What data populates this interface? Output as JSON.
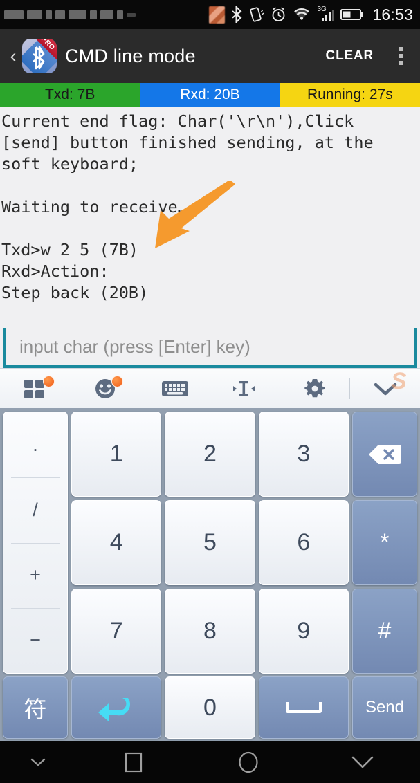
{
  "status_bar": {
    "time": "16:53",
    "network_label": "3G",
    "icons": [
      "notification-blurred",
      "bluetooth-icon",
      "vibrate-icon",
      "alarm-icon",
      "wifi-icon",
      "signal-3g-icon",
      "battery-icon"
    ]
  },
  "app_bar": {
    "back_label": "‹",
    "app_icon_badge": "PRO",
    "title": "CMD line mode",
    "clear_label": "CLEAR",
    "overflow_label": "overflow-menu"
  },
  "status_strips": [
    {
      "label": "Txd: 7B",
      "color": "#2ba52b",
      "text_color": "#1a1a1a"
    },
    {
      "label": "Rxd: 20B",
      "color": "#1477e8",
      "text_color": "#ffffff"
    },
    {
      "label": "Running: 27s",
      "color": "#f5d512",
      "text_color": "#1a1a1a"
    }
  ],
  "terminal": {
    "log": "Current end flag: Char('\\r\\n'),Click [send] button finished sending, at the soft keyboard;\n\nWaiting to receive…\n\nTxd>w 2 5 (7B)\nRxd>Action:\nStep back (20B)",
    "background": "#f0f0f2"
  },
  "annotation": {
    "type": "arrow",
    "color": "#f59a2e",
    "points_to": "input-field"
  },
  "input": {
    "value": "",
    "placeholder": "input char (press [Enter] key)",
    "underline_color": "#1a8a9e"
  },
  "ime_toolbar": {
    "items": [
      {
        "name": "apps-grid-icon",
        "badge": true
      },
      {
        "name": "emoji-smiley-icon",
        "badge": true
      },
      {
        "name": "keyboard-icon",
        "badge": false
      },
      {
        "name": "cursor-move-icon",
        "badge": false
      },
      {
        "name": "gear-icon",
        "badge": false
      },
      {
        "name": "chevron-down-icon",
        "badge": false
      }
    ],
    "watermark": "S"
  },
  "keyboard": {
    "function_column": [
      ".",
      "/",
      "+",
      "−"
    ],
    "rows": [
      [
        {
          "label": "1",
          "type": "digit"
        },
        {
          "label": "2",
          "type": "digit"
        },
        {
          "label": "3",
          "type": "digit"
        },
        {
          "label": "backspace-icon",
          "type": "blue-icon"
        }
      ],
      [
        {
          "label": "4",
          "type": "digit"
        },
        {
          "label": "5",
          "type": "digit"
        },
        {
          "label": "6",
          "type": "digit"
        },
        {
          "label": "*",
          "type": "blue"
        }
      ],
      [
        {
          "label": "7",
          "type": "digit"
        },
        {
          "label": "8",
          "type": "digit"
        },
        {
          "label": "9",
          "type": "digit"
        },
        {
          "label": "#",
          "type": "blue"
        }
      ]
    ],
    "bottom_row": [
      {
        "label": "符",
        "type": "blue"
      },
      {
        "label": "return-arrow-icon",
        "type": "blue-icon"
      },
      {
        "label": "0",
        "type": "digit"
      },
      {
        "label": "space-icon",
        "type": "blue-icon"
      },
      {
        "label": "Send",
        "type": "blue"
      }
    ],
    "key_color": "#7d95bd",
    "background": "#93a0b0"
  },
  "nav_bar": {
    "items": [
      "hide-keyboard-icon",
      "recents-square-icon",
      "home-circle-icon",
      "back-chevron-icon"
    ]
  }
}
